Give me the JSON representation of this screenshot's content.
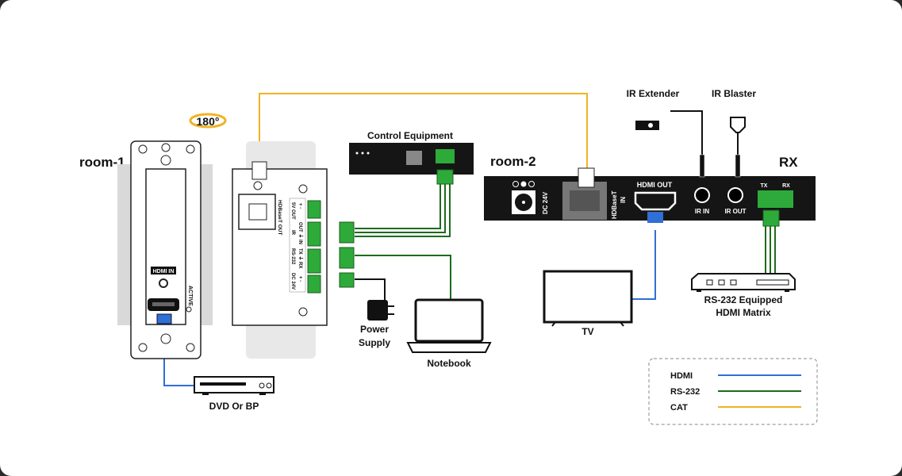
{
  "labels": {
    "room1": "room-1",
    "room2": "room-2",
    "rx": "RX",
    "rotate": "180°",
    "control_equipment": "Control Equipment",
    "power_supply_1": "Power",
    "power_supply_2": "Supply",
    "notebook": "Notebook",
    "dvd": "DVD Or BP",
    "tv": "TV",
    "ir_extender": "IR Extender",
    "ir_blaster": "IR Blaster",
    "matrix_1": "RS-232 Equipped",
    "matrix_2": "HDMI Matrix"
  },
  "tx_plate": {
    "hdmi_in": "HDMI IN",
    "active": "ACTIVE"
  },
  "tx_back": {
    "hdbaset_out": "HDBaseT OUT",
    "5v_out": "5V OUT",
    "5v_pins": "+   -",
    "ir": "IR",
    "ir_pins": "OUT ⏚ IN",
    "rs232": "RS-232",
    "rs232_pins": "TX ⏚ RX",
    "dc24v": "DC 24V",
    "dc_pins": "+   -"
  },
  "rx_panel": {
    "dc24v": "DC 24V",
    "hdbaset_in_1": "HDBaseT",
    "hdbaset_in_2": "IN",
    "hdmi_out": "HDMI OUT",
    "ir_in": "IR IN",
    "ir_out": "IR OUT",
    "tx": "TX",
    "rxpin": "RX"
  },
  "legend": [
    {
      "label": "HDMI",
      "color": "#2f6fd6"
    },
    {
      "label": "RS-232",
      "color": "#1d6b1d"
    },
    {
      "label": "CAT",
      "color": "#f0b323"
    }
  ],
  "colors": {
    "hdmi": "#2f6fd6",
    "rs232": "#1d6b1d",
    "cat": "#f0b323",
    "device": "#151515",
    "terminal": "#2eaa3a"
  }
}
